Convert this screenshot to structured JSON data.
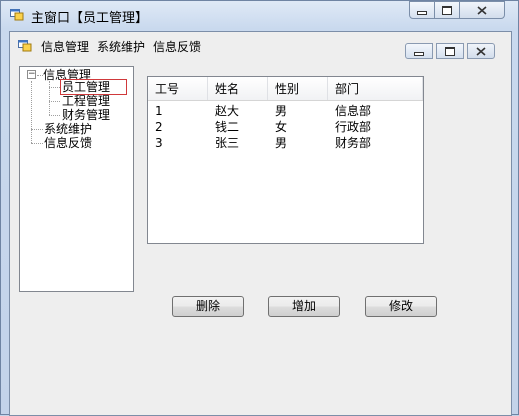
{
  "window": {
    "title": "主窗口【员工管理】",
    "icon": "app-window-icon"
  },
  "menubar": {
    "items": [
      "信息管理",
      "系统维护",
      "信息反馈"
    ]
  },
  "tree": {
    "root": "信息管理",
    "children": [
      "员工管理",
      "工程管理",
      "财务管理"
    ],
    "siblings": [
      "系统维护",
      "信息反馈"
    ],
    "expander": "⊟",
    "selected": "员工管理"
  },
  "listview": {
    "columns": [
      "工号",
      "姓名",
      "性别",
      "部门"
    ],
    "rows": [
      [
        "1",
        "赵大",
        "男",
        "信息部"
      ],
      [
        "2",
        "钱二",
        "女",
        "行政部"
      ],
      [
        "3",
        "张三",
        "男",
        "财务部"
      ]
    ]
  },
  "buttons": {
    "delete": "删除",
    "add": "增加",
    "edit": "修改"
  },
  "colors": {
    "selection_outline": "#d0393b",
    "titlebar": "#c9d9ee"
  }
}
